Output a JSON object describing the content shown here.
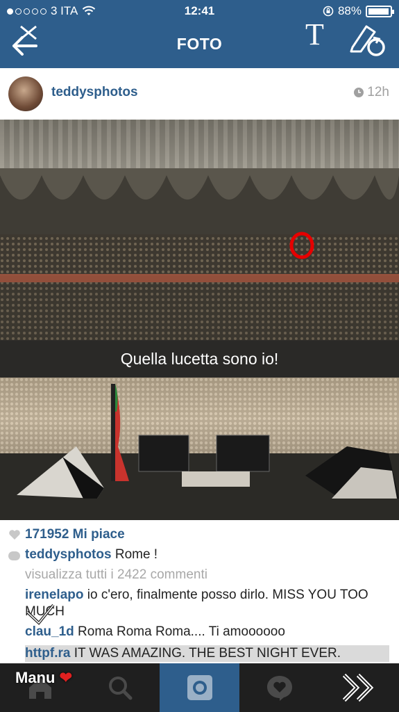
{
  "status_bar": {
    "carrier": "3 ITA",
    "time": "12:41",
    "battery": "88%"
  },
  "header": {
    "title": "FOTO",
    "overlay_text_tool": "T"
  },
  "post": {
    "username": "teddysphotos",
    "time_ago": "12h",
    "photo_caption_overlay": "Quella lucetta sono io!",
    "likes": "171952 Mi piace",
    "caption_user": "teddysphotos",
    "caption_text": "Rome !",
    "view_all_comments": "visualizza tutti i 2422 commenti",
    "comments": [
      {
        "user": "irenelapo",
        "text": "io c'ero, finalmente posso dirlo. MISS YOU TOO MUCH"
      },
      {
        "user": "clau_1d",
        "text": "Roma Roma Roma.... Ti amoooooo"
      },
      {
        "user": "httpf.ra",
        "text": "IT WAS AMAZING. THE BEST NIGHT EVER."
      }
    ]
  },
  "overlay_label": "Manu",
  "colors": {
    "brand": "#2e5e8c",
    "marker": "#e60000",
    "muted": "#a8a8a8"
  },
  "icons": [
    "back-arrow-icon",
    "close-icon",
    "text-tool-icon",
    "draw-tool-icon",
    "clock-icon",
    "heart-icon",
    "comment-icon",
    "home-icon",
    "search-icon",
    "camera-icon",
    "activity-icon",
    "chevron-icon"
  ]
}
